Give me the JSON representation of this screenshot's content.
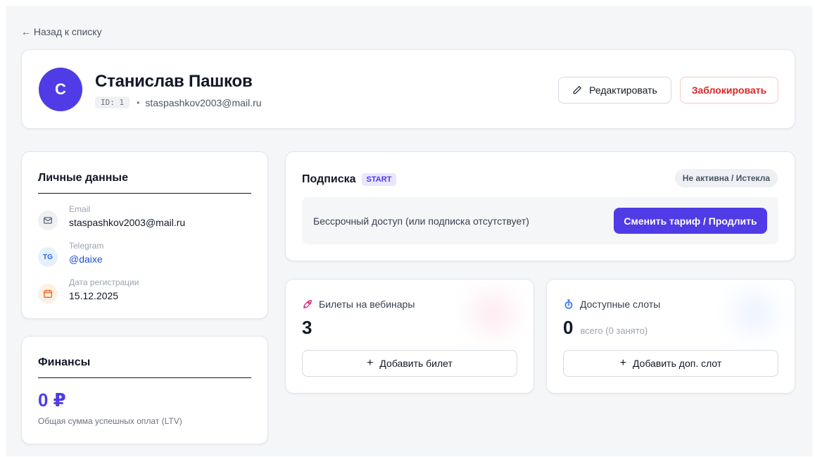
{
  "nav": {
    "back_label": "← Назад к списку"
  },
  "user": {
    "avatar_letter": "С",
    "name": "Станислав Пашков",
    "id_badge": "ID: 1",
    "separator": "•",
    "email": "staspashkov2003@mail.ru"
  },
  "actions": {
    "edit_label": "Редактировать",
    "block_label": "Заблокировать"
  },
  "personal": {
    "title": "Личные данные",
    "items": [
      {
        "label": "Email",
        "value": "staspashkov2003@mail.ru",
        "icon": "mail-icon"
      },
      {
        "label": "Telegram",
        "value": "@daixe",
        "icon": "telegram-icon",
        "icon_text": "TG"
      },
      {
        "label": "Дата регистрации",
        "value": "15.12.2025",
        "icon": "calendar-icon"
      }
    ]
  },
  "finance": {
    "title": "Финансы",
    "amount": "0 ₽",
    "caption": "Общая сумма успешных оплат (LTV)"
  },
  "subscription": {
    "title": "Подписка",
    "plan": "START",
    "status": "Не активна / Истекла",
    "description": "Бессрочный доступ (или подписка отсутствует)",
    "action_label": "Сменить тариф / Продлить"
  },
  "tickets": {
    "label": "Билеты на вебинары",
    "value": "3",
    "add_label": "Добавить билет",
    "icon": "rocket-icon"
  },
  "slots": {
    "label": "Доступные слоты",
    "value": "0",
    "sub": "всего (0 занято)",
    "add_label": "Добавить доп. слот",
    "icon": "stopwatch-icon"
  },
  "colors": {
    "primary": "#4f3ce6",
    "danger": "#dc2626",
    "link": "#1d4ed8",
    "background": "#f5f6f8"
  }
}
